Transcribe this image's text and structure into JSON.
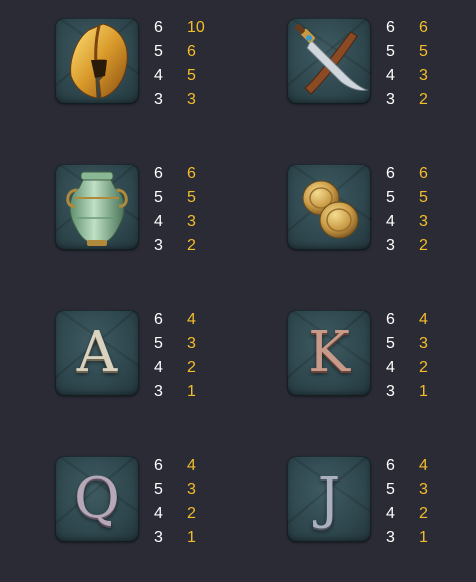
{
  "symbols": [
    {
      "name": "helmet",
      "icon": "spartan-helmet",
      "pays": [
        {
          "count": "6",
          "mult": "10"
        },
        {
          "count": "5",
          "mult": "6"
        },
        {
          "count": "4",
          "mult": "5"
        },
        {
          "count": "3",
          "mult": "3"
        }
      ]
    },
    {
      "name": "dagger",
      "icon": "dagger-and-scabbard",
      "pays": [
        {
          "count": "6",
          "mult": "6"
        },
        {
          "count": "5",
          "mult": "5"
        },
        {
          "count": "4",
          "mult": "3"
        },
        {
          "count": "3",
          "mult": "2"
        }
      ]
    },
    {
      "name": "vase",
      "icon": "green-amphora",
      "pays": [
        {
          "count": "6",
          "mult": "6"
        },
        {
          "count": "5",
          "mult": "5"
        },
        {
          "count": "4",
          "mult": "3"
        },
        {
          "count": "3",
          "mult": "2"
        }
      ]
    },
    {
      "name": "coins",
      "icon": "gold-coins",
      "pays": [
        {
          "count": "6",
          "mult": "6"
        },
        {
          "count": "5",
          "mult": "5"
        },
        {
          "count": "4",
          "mult": "3"
        },
        {
          "count": "3",
          "mult": "2"
        }
      ]
    },
    {
      "name": "A",
      "icon": "letter-a",
      "letter": "A",
      "pays": [
        {
          "count": "6",
          "mult": "4"
        },
        {
          "count": "5",
          "mult": "3"
        },
        {
          "count": "4",
          "mult": "2"
        },
        {
          "count": "3",
          "mult": "1"
        }
      ]
    },
    {
      "name": "K",
      "icon": "letter-k",
      "letter": "K",
      "pays": [
        {
          "count": "6",
          "mult": "4"
        },
        {
          "count": "5",
          "mult": "3"
        },
        {
          "count": "4",
          "mult": "2"
        },
        {
          "count": "3",
          "mult": "1"
        }
      ]
    },
    {
      "name": "Q",
      "icon": "letter-q",
      "letter": "Q",
      "pays": [
        {
          "count": "6",
          "mult": "4"
        },
        {
          "count": "5",
          "mult": "3"
        },
        {
          "count": "4",
          "mult": "2"
        },
        {
          "count": "3",
          "mult": "1"
        }
      ]
    },
    {
      "name": "J",
      "icon": "letter-j",
      "letter": "J",
      "pays": [
        {
          "count": "6",
          "mult": "4"
        },
        {
          "count": "5",
          "mult": "3"
        },
        {
          "count": "4",
          "mult": "2"
        },
        {
          "count": "3",
          "mult": "1"
        }
      ]
    }
  ],
  "colors": {
    "background": "#2b2b36",
    "count_text": "#ffffff",
    "multiplier_text": "#f4be2a"
  }
}
